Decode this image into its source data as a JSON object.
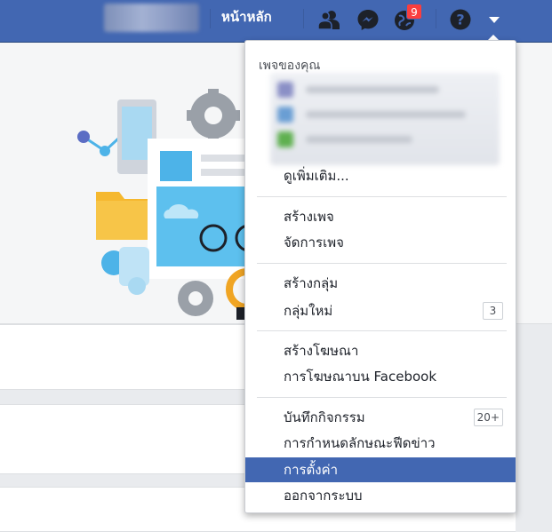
{
  "topbar": {
    "home_label": "หน้าหลัก",
    "notification_count": "9"
  },
  "menu": {
    "header": "เพจของคุณ",
    "items": [
      {
        "label": "ดูเพิ่มเติม..."
      },
      {
        "label": "สร้างเพจ"
      },
      {
        "label": "จัดการเพจ"
      },
      {
        "label": "สร้างกลุ่ม"
      },
      {
        "label": "กลุ่มใหม่",
        "count": "3"
      },
      {
        "label": "สร้างโฆษณา"
      },
      {
        "label": "การโฆษณาบน Facebook"
      },
      {
        "label": "บันทึกกิจกรรม",
        "count": "20+"
      },
      {
        "label": "การกำหนดลักษณะฟีดข่าว"
      },
      {
        "label": "การตั้งค่า",
        "active": true
      },
      {
        "label": "ออกจากระบบ"
      }
    ]
  },
  "colors": {
    "brand": "#4267b2",
    "badge": "#fa3e3e",
    "active_item": "#4267b2"
  },
  "icons": [
    "friends-icon",
    "messenger-icon",
    "notifications-globe-icon",
    "help-icon",
    "caret-down-icon"
  ]
}
